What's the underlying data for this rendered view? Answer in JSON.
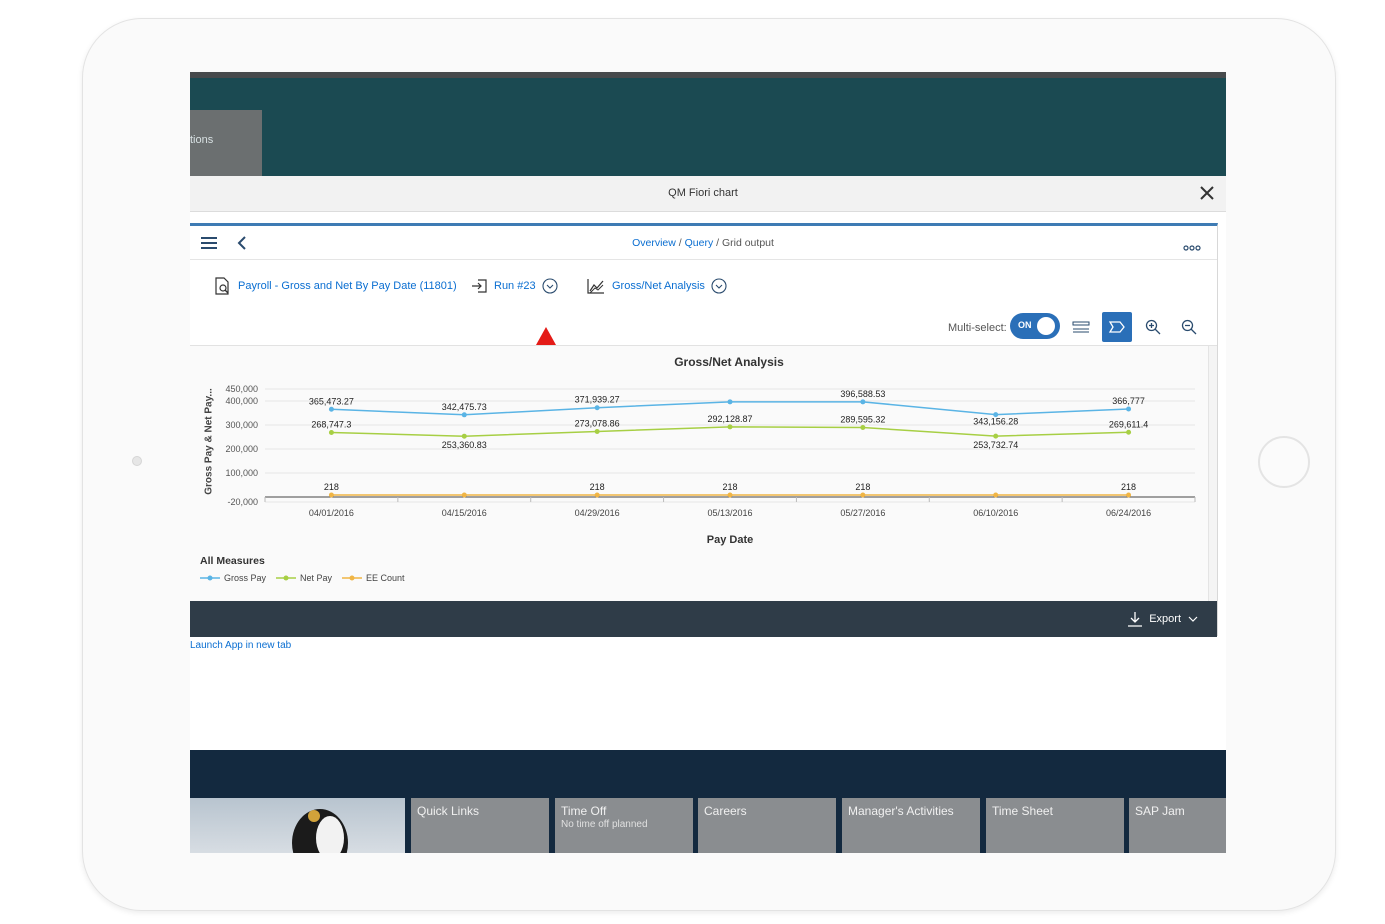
{
  "dialog": {
    "title": "QM Fiori chart"
  },
  "background": {
    "tile_text": "tions"
  },
  "shell": {
    "breadcrumb": {
      "overview": "Overview",
      "sep1": " / ",
      "query": "Query",
      "sep2": " / ",
      "current": "Grid output"
    }
  },
  "toolbar": {
    "report_label": "Payroll - Gross and Net By Pay Date (11801)",
    "run_label": "Run #23",
    "analysis_label": "Gross/Net Analysis",
    "multiselect_label": "Multi-select:",
    "toggle_text": "ON"
  },
  "chart_data": {
    "type": "line",
    "title": "Gross/Net Analysis",
    "xlabel": "Pay Date",
    "ylabel": "Gross Pay & Net Pay...",
    "categories": [
      "04/01/2016",
      "04/15/2016",
      "04/29/2016",
      "05/13/2016",
      "05/27/2016",
      "06/10/2016",
      "06/24/2016"
    ],
    "y_ticks": [
      "450,000",
      "400,000",
      "300,000",
      "200,000",
      "100,000",
      "-20,000"
    ],
    "ylim": [
      -20000,
      450000
    ],
    "series": [
      {
        "name": "Gross Pay",
        "color": "#5ab4e5",
        "values": [
          365473.27,
          342475.73,
          371939.27,
          396588.53,
          396588.53,
          343156.28,
          366777
        ],
        "labels": [
          "365,473.27",
          "342,475.73",
          "371,939.27",
          "",
          "396,588.53",
          "343,156.28",
          "366,777"
        ]
      },
      {
        "name": "Net Pay",
        "color": "#a7cf44",
        "values": [
          268747.3,
          253360.83,
          273078.86,
          292128.87,
          289595.32,
          253732.74,
          269611.4
        ],
        "labels": [
          "268,747.3",
          "253,360.83",
          "273,078.86",
          "292,128.87",
          "289,595.32",
          "253,732.74",
          "269,611.4"
        ]
      },
      {
        "name": "EE Count",
        "color": "#f0b545",
        "values": [
          218,
          218,
          218,
          218,
          218,
          218,
          218
        ],
        "labels": [
          "218",
          "",
          "218",
          "218",
          "218",
          "",
          "218"
        ]
      }
    ],
    "legend_title": "All Measures",
    "grid": true
  },
  "footer": {
    "export_label": "Export"
  },
  "launch_link": "Launch App in new tab",
  "tiles": [
    {
      "title": "Quick Links",
      "subtitle": ""
    },
    {
      "title": "Time Off",
      "subtitle": "No time off planned"
    },
    {
      "title": "Careers",
      "subtitle": ""
    },
    {
      "title": "Manager's Activities",
      "subtitle": ""
    },
    {
      "title": "Time Sheet",
      "subtitle": ""
    },
    {
      "title": "SAP Jam",
      "subtitle": ""
    }
  ]
}
